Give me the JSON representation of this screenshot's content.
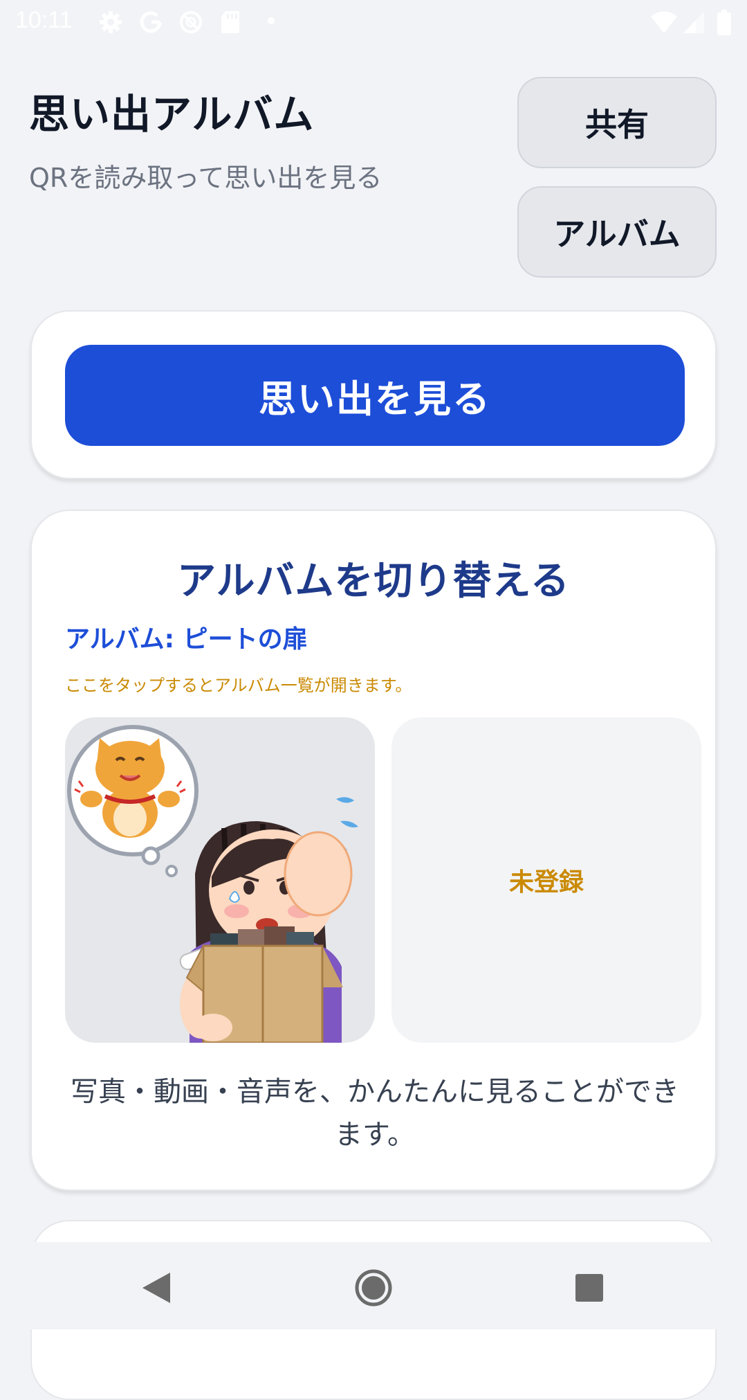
{
  "status_bar": {
    "time": "10:11",
    "icons": [
      "gear-icon",
      "google-icon",
      "no-disturb-icon",
      "sd-card-icon",
      "dot-icon",
      "wifi-icon",
      "signal-icon",
      "battery-icon"
    ]
  },
  "header": {
    "title": "思い出アルバム",
    "subtitle": "QRを読み取って思い出を見る",
    "share_label": "共有",
    "album_label": "アルバム"
  },
  "view_card": {
    "button_label": "思い出を見る"
  },
  "switch_card": {
    "title": "アルバムを切り替える",
    "current_album": "アルバム: ピートの扉",
    "hint": "ここをタップするとアルバム一覧が開きます。",
    "empty_label": "未登録",
    "description": "写真・動画・音声を、かんたんに見ることができます。"
  },
  "colors": {
    "primary": "#1d4ed8",
    "title_navy": "#1e3a8a",
    "accent_gold": "#ca8a04",
    "background": "#f2f3f6"
  },
  "nav_bar": {
    "icons": [
      "back-icon",
      "home-icon",
      "recents-icon"
    ]
  }
}
